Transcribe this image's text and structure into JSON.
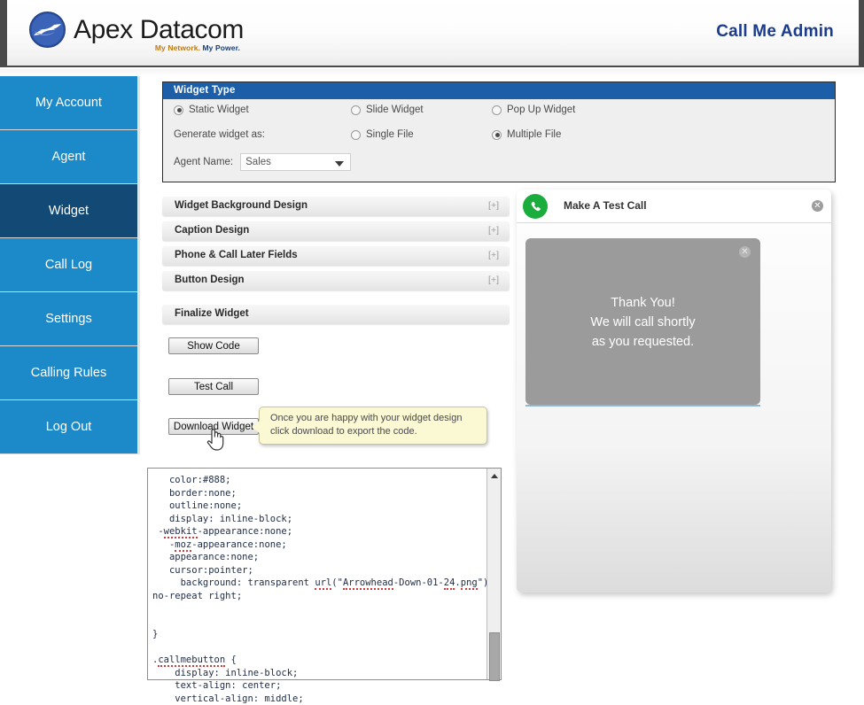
{
  "header": {
    "logo_word": "Apex Datacom",
    "tagline_part1": "My Network.",
    "tagline_part2": " My Power.",
    "admin_title": "Call Me Admin",
    "logo_icon": "globe-swoosh-logo"
  },
  "sidebar": {
    "items": [
      {
        "label": "My Account",
        "active": false
      },
      {
        "label": "Agent",
        "active": false
      },
      {
        "label": "Widget",
        "active": true
      },
      {
        "label": "Call Log",
        "active": false
      },
      {
        "label": "Settings",
        "active": false
      },
      {
        "label": "Calling Rules",
        "active": false
      },
      {
        "label": "Log Out",
        "active": false
      }
    ],
    "active_color": "#134a75",
    "base_color": "#1c8ac9"
  },
  "widget_type": {
    "panel_title": "Widget Type",
    "header_color": "#1c5ea8",
    "radios_row1": [
      {
        "label": "Static Widget",
        "selected": true
      },
      {
        "label": "Slide Widget",
        "selected": false
      },
      {
        "label": "Pop Up Widget",
        "selected": false
      }
    ],
    "generate_label": "Generate widget as:",
    "radios_row2": [
      {
        "label": "Single File",
        "selected": false
      },
      {
        "label": "Multiple File",
        "selected": true
      }
    ],
    "agent_name_label": "Agent Name:",
    "agent_name_value": "Sales",
    "agent_name_options": [
      "Sales"
    ]
  },
  "sections": [
    {
      "title": "Widget Background Design",
      "toggle": "[+]"
    },
    {
      "title": "Caption Design",
      "toggle": "[+]"
    },
    {
      "title": "Phone & Call Later Fields",
      "toggle": "[+]"
    },
    {
      "title": "Button Design",
      "toggle": "[+]"
    }
  ],
  "finalize": {
    "title": "Finalize Widget",
    "show_code_label": "Show Code",
    "test_call_label": "Test Call",
    "download_label": "Download Widget"
  },
  "tooltip": {
    "line1": "Once you are happy with your widget design",
    "line2": "click download to export the code.",
    "background": "#fbf8d4"
  },
  "code_box": {
    "lines": [
      "   color:#888;",
      "   border:none;",
      "   outline:none;",
      "   display: inline-block;",
      " -webkit-appearance:none;",
      "   -moz-appearance:none;",
      "   appearance:none;",
      "   cursor:pointer;",
      "     background: transparent url(\"Arrowhead-Down-01-24.png\")",
      "no-repeat right;",
      "",
      "",
      "}",
      "",
      ".callmebutton {",
      "    display: inline-block;",
      "    text-align: center;",
      "    vertical-align: middle;"
    ],
    "scrollbar_up_icon": "caret-up-icon"
  },
  "preview": {
    "title": "Make A Test Call",
    "phone_icon": "phone-icon",
    "phone_icon_color": "#1aad3d",
    "close_icon": "close-circle-icon",
    "close_glyph": "✕",
    "thankyou": {
      "close_glyph": "✕",
      "line1": "Thank You!",
      "line2": "We will call shortly",
      "line3": "as you requested.",
      "background": "#9b9b9b"
    }
  }
}
